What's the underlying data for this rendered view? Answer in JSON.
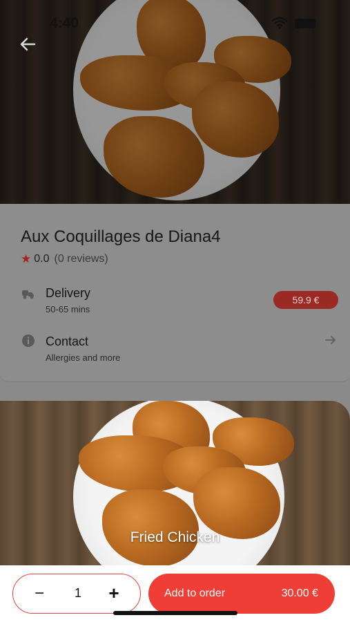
{
  "status_bar": {
    "time": "4:40"
  },
  "restaurant": {
    "name": "Aux Coquillages de Diana4",
    "rating": "0.0",
    "reviews": "(0 reviews)"
  },
  "delivery": {
    "title": "Delivery",
    "time": "50-65 mins",
    "price": "59.9 €"
  },
  "contact": {
    "title": "Contact",
    "subtitle": "Allergies and more"
  },
  "product": {
    "name": "Fried Chicken"
  },
  "order": {
    "minus": "−",
    "quantity": "1",
    "plus": "+",
    "add_label": "Add to order",
    "total": "30.00 €"
  },
  "colors": {
    "accent": "#ee3e36",
    "overlay": "#8d8d8d"
  },
  "icons": [
    "back-arrow-icon",
    "wifi-icon",
    "battery-icon",
    "star-icon",
    "delivery-icon",
    "info-icon",
    "arrow-right-icon"
  ]
}
